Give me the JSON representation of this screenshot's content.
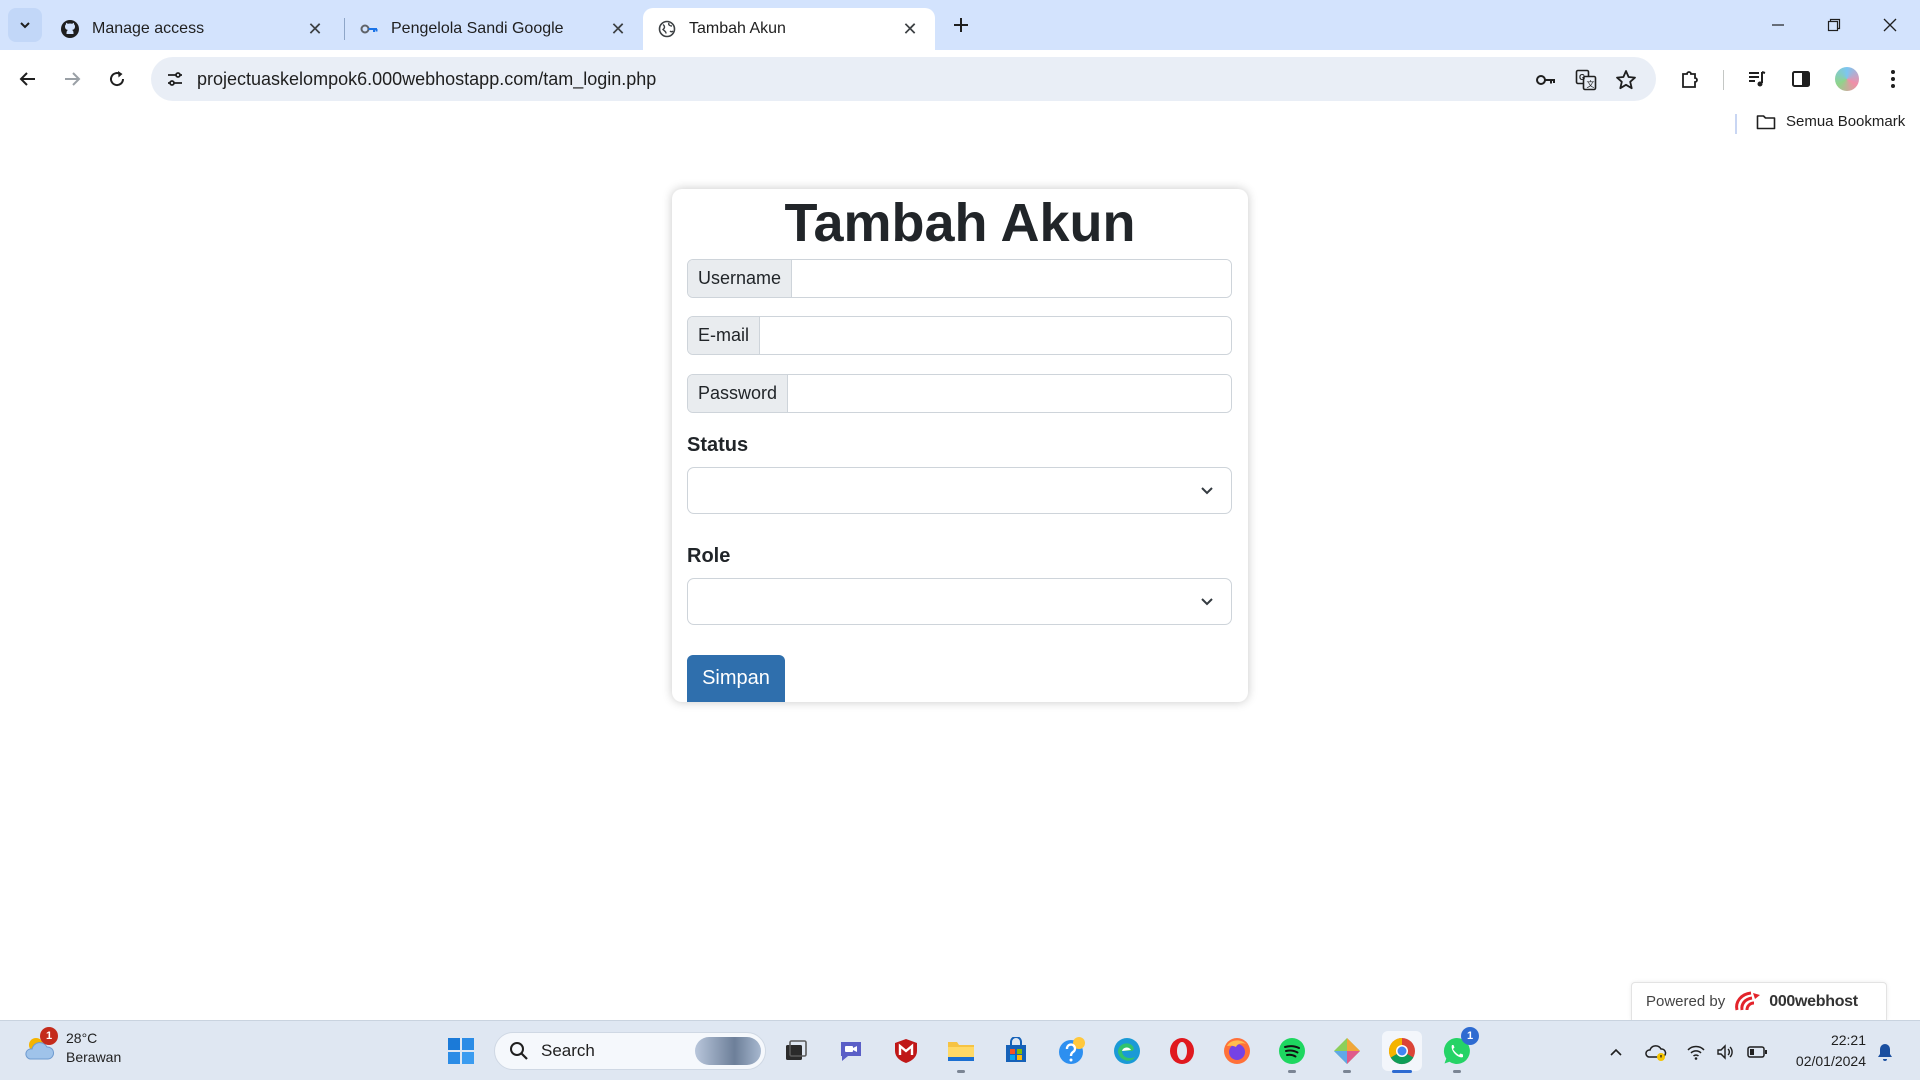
{
  "browser": {
    "tabs": [
      {
        "title": "Manage access",
        "icon": "github-icon",
        "active": false
      },
      {
        "title": "Pengelola Sandi Google",
        "icon": "key-icon",
        "active": false
      },
      {
        "title": "Tambah Akun",
        "icon": "globe-icon",
        "active": true
      }
    ],
    "url": "projectuaskelompok6.000webhostapp.com/tam_login.php",
    "bookmarks_all_label": "Semua Bookmark"
  },
  "form": {
    "title": "Tambah Akun",
    "username_label": "Username",
    "email_label": "E-mail",
    "password_label": "Password",
    "username_value": "",
    "email_value": "",
    "password_value": "",
    "status_label": "Status",
    "status_value": "",
    "role_label": "Role",
    "role_value": "",
    "submit_label": "Simpan",
    "submit_color": "#2f6fad"
  },
  "powered_by": {
    "prefix": "Powered by",
    "brand": "000webhost"
  },
  "taskbar": {
    "weather_temp": "28°C",
    "weather_desc": "Berawan",
    "weather_badge": "1",
    "search_placeholder": "Search",
    "whatsapp_badge": "1",
    "time": "22:21",
    "date": "02/01/2024"
  }
}
